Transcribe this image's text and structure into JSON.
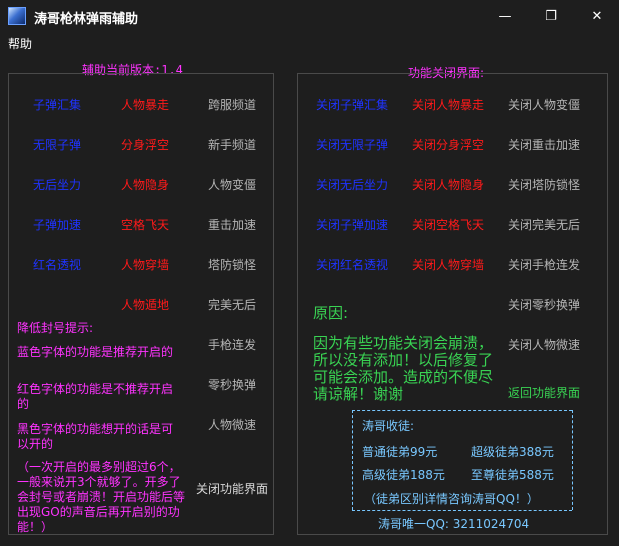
{
  "window": {
    "title": "涛哥枪林弹雨辅助",
    "minimize_glyph": "—",
    "maximize_glyph": "❐",
    "close_glyph": "✕"
  },
  "menu": {
    "help": "帮助"
  },
  "left": {
    "version_label": "辅助当前版本:1.4",
    "col1": [
      "子弹汇集",
      "无限子弹",
      "无后坐力",
      "子弹加速",
      "红名透视"
    ],
    "col2": [
      "人物暴走",
      "分身浮空",
      "人物隐身",
      "空格飞天",
      "人物穿墙",
      "人物遁地"
    ],
    "col3": [
      "跨服频道",
      "新手频道",
      "人物变僵",
      "重击加速",
      "塔防锁怪",
      "完美无后",
      "手枪连发",
      "零秒换弹",
      "人物微速"
    ],
    "tip_title": "降低封号提示:",
    "tip_blue": "蓝色字体的功能是推荐开启的",
    "tip_red": "红色字体的功能是不推荐开启的",
    "tip_black": "黑色字体的功能想开的话是可以开的",
    "tip_warning": "（一次开启的最多别超过6个，一般来说开3个就够了。开多了会封号或者崩溃！开启功能后等出现GO的声音后再开启别的功能！）",
    "close_panel": "关闭功能界面"
  },
  "right": {
    "panel_label": "功能关闭界面:",
    "col1": [
      "关闭子弹汇集",
      "关闭无限子弹",
      "关闭无后坐力",
      "关闭子弹加速",
      "关闭红名透视"
    ],
    "col2": [
      "关闭人物暴走",
      "关闭分身浮空",
      "关闭人物隐身",
      "关闭空格飞天",
      "关闭人物穿墙"
    ],
    "col3": [
      "关闭人物变僵",
      "关闭重击加速",
      "关闭塔防锁怪",
      "关闭完美无后",
      "关闭手枪连发",
      "关闭零秒换弹",
      "关闭人物微速"
    ],
    "reason_title": "原因:",
    "reason_text": "因为有些功能关闭会崩溃，所以没有添加！以后修复了可能会添加。造成的不便尽请谅解！谢谢",
    "back_button": "返回功能界面",
    "apprentice_title": "涛哥收徒:",
    "apprentice": [
      {
        "name": "普通徒弟",
        "price": "99元"
      },
      {
        "name": "超级徒弟",
        "price": "388元"
      },
      {
        "name": "高级徒弟",
        "price": "188元"
      },
      {
        "name": "至尊徒弟",
        "price": "588元"
      }
    ],
    "apprentice_note": "（徒弟区别详情咨询涛哥QQ！）",
    "qq_label": "涛哥唯一QQ: 3211024704"
  },
  "colors": {
    "recommended": "#1f33ff",
    "not_recommended": "#ff1a1a",
    "optional": "#b5b5b5",
    "tips": "#ff33ff",
    "reason": "#39d353",
    "promo": "#79c8ff"
  }
}
